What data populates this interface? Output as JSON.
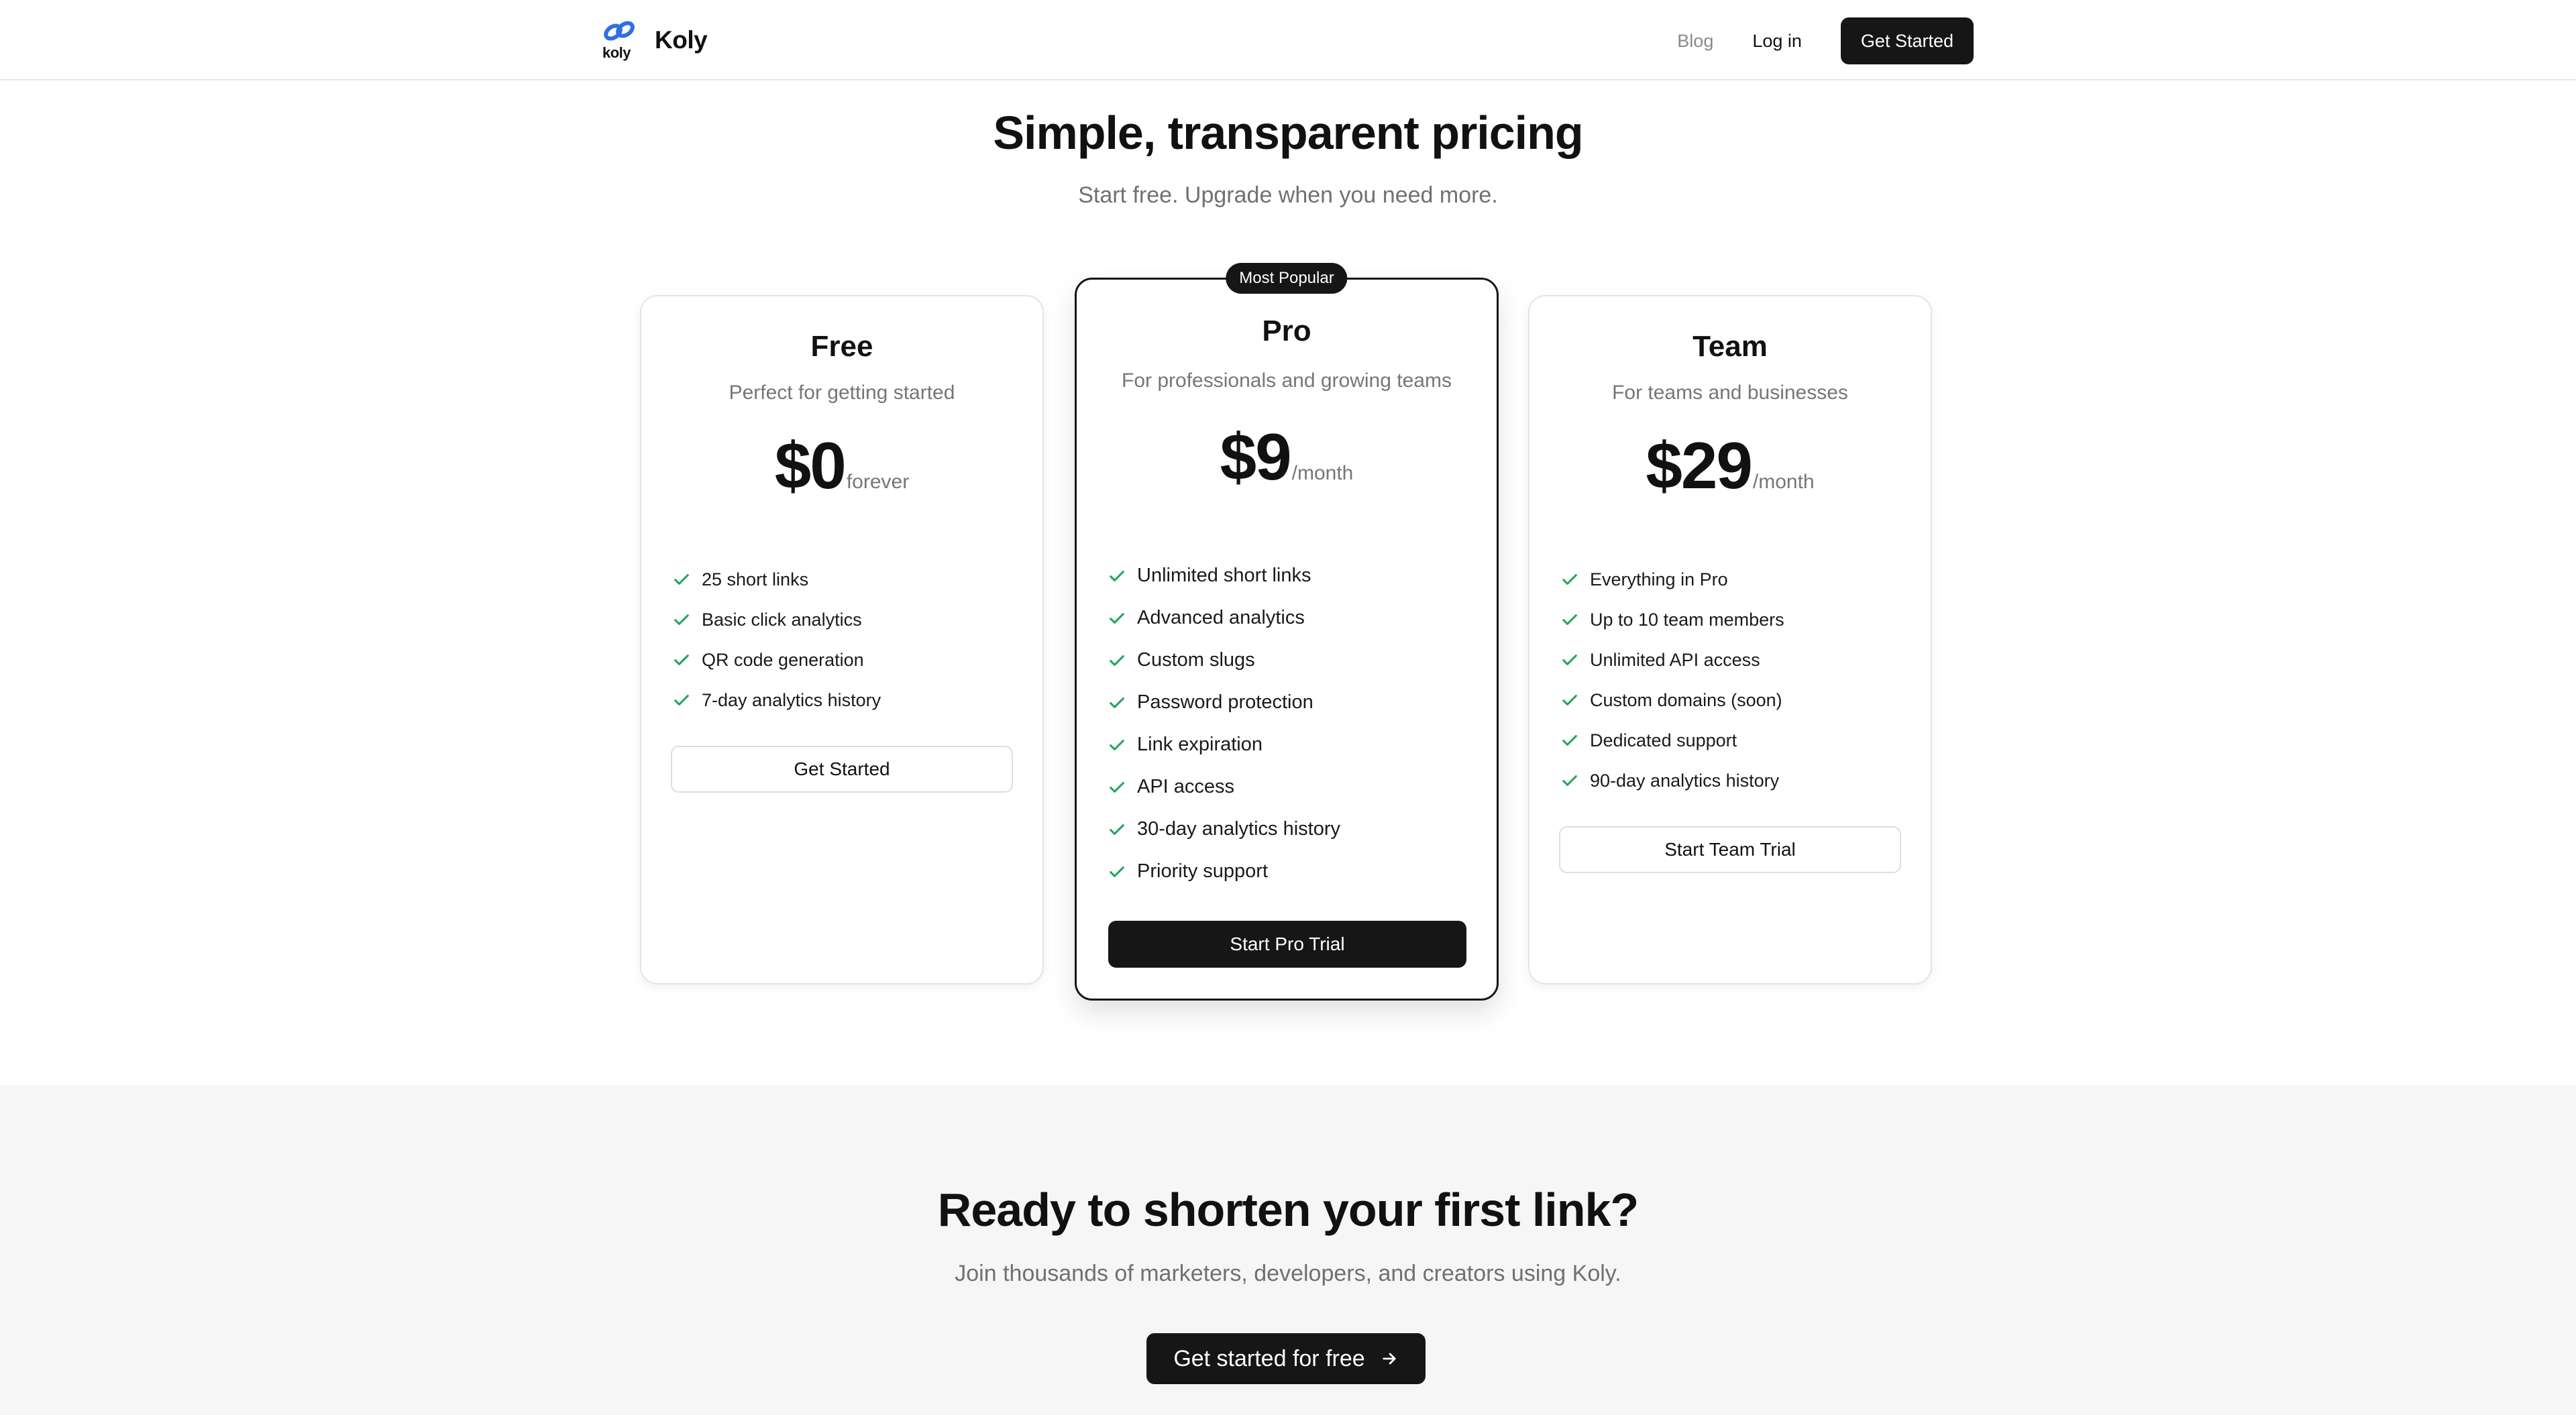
{
  "nav": {
    "logo_text": "koly",
    "brand_name": "Koly",
    "blog_label": "Blog",
    "login_label": "Log in",
    "cta_label": "Get Started"
  },
  "hero": {
    "title": "Simple, transparent pricing",
    "subtitle": "Start free. Upgrade when you need more."
  },
  "plans": [
    {
      "name": "Free",
      "description": "Perfect for getting started",
      "price": "$0",
      "period": "forever",
      "features": [
        "25 short links",
        "Basic click analytics",
        "QR code generation",
        "7-day analytics history"
      ],
      "button_label": "Get Started"
    },
    {
      "badge": "Most Popular",
      "name": "Pro",
      "description": "For professionals and growing teams",
      "price": "$9",
      "period": "/month",
      "features": [
        "Unlimited short links",
        "Advanced analytics",
        "Custom slugs",
        "Password protection",
        "Link expiration",
        "API access",
        "30-day analytics history",
        "Priority support"
      ],
      "button_label": "Start Pro Trial"
    },
    {
      "name": "Team",
      "description": "For teams and businesses",
      "price": "$29",
      "period": "/month",
      "features": [
        "Everything in Pro",
        "Up to 10 team members",
        "Unlimited API access",
        "Custom domains (soon)",
        "Dedicated support",
        "90-day analytics history"
      ],
      "button_label": "Start Team Trial"
    }
  ],
  "cta": {
    "title": "Ready to shorten your first link?",
    "subtitle": "Join thousands of marketers, developers, and creators using Koly.",
    "button_label": "Get started for free"
  },
  "icons": {
    "check": "check-icon",
    "arrow": "arrow-right-icon",
    "logo": "link-logo-icon"
  },
  "colors": {
    "primary_dark": "#161616",
    "check_green": "#22a55a",
    "logo_blue": "#2f6fe4",
    "muted_text": "#767676",
    "section_bg": "#f6f6f6"
  }
}
